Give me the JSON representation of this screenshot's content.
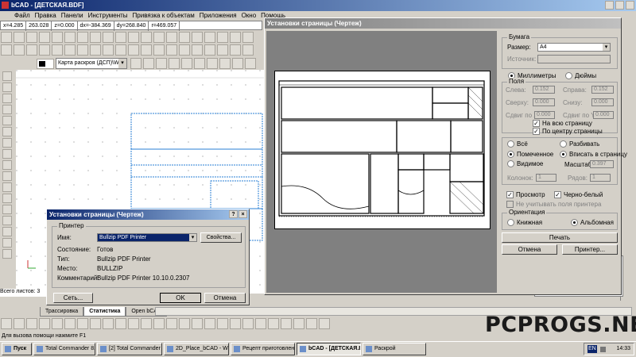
{
  "app": {
    "title": "bCAD - [ДЕТСКАЯ.BDF]",
    "menu": [
      "Файл",
      "Правка",
      "Панели",
      "Инструменты",
      "Привязка к объектам",
      "Приложения",
      "Окно",
      "Помощь"
    ],
    "coords": [
      "x=4.285",
      "263.028",
      "z=0.000",
      "dx=-384.369",
      "dy=268.840",
      "r=469.057"
    ],
    "layer_value": "Карта раскроя (ДСП)\\WB",
    "status_tabs": [
      "Трассировка",
      "Статистика",
      "Open bCAD"
    ],
    "status_hint": "Для вызова помощи нажмите F1",
    "sheet_count": "Всего листов: 3"
  },
  "small_dialog": {
    "title": "Установки страницы (Чертеж)",
    "group_printer": "Принтер",
    "name_label": "Имя:",
    "name_value": "Bullzip PDF Printer",
    "props_button": "Свойства...",
    "rows": [
      {
        "label": "Состояние:",
        "value": "Готов"
      },
      {
        "label": "Тип:",
        "value": "Bullzip PDF Printer"
      },
      {
        "label": "Место:",
        "value": "BULLZIP"
      },
      {
        "label": "Комментарий:",
        "value": "Bullzip PDF Printer 10.10.0.2307"
      }
    ],
    "net_button": "Сеть...",
    "ok_button": "OK",
    "cancel_button": "Отмена"
  },
  "large_dialog": {
    "title": "Установки страницы (Чертеж)",
    "paper_group": "Бумага",
    "size_label": "Размер:",
    "size_value": "A4",
    "source_label": "Источник:",
    "millimeters": "Миллиметры",
    "inches": "Дюймы",
    "margins_group": "Поля",
    "left_label": "Слева:",
    "left_value": "0.152",
    "right_label": "Справа:",
    "right_value": "0.152",
    "top_label": "Сверху:",
    "top_value": "0.000",
    "bottom_label": "Снизу:",
    "bottom_value": "0.000",
    "shiftx_label": "Сдвиг по X:",
    "shiftx_value": "0.000",
    "shifty_label": "Сдвиг по Y:",
    "shifty_value": "0.000",
    "whole_page": "На всю страницу",
    "center_page": "По центру страницы",
    "all": "Всё",
    "split": "Разбивать",
    "marked": "Помеченное",
    "fit_page": "Вписать в страницу",
    "visible": "Видимое",
    "scale_label": "Масштаб:",
    "scale_value": "0.397",
    "columns_label": "Колонок:",
    "columns_value": "1",
    "rows_label": "Рядов:",
    "rows_value": "1",
    "preview": "Просмотр",
    "bw": "Черно-белый",
    "no_scale": "Не учитывать поля принтера",
    "orientation_group": "Ориентация",
    "portrait": "Книжная",
    "landscape": "Альбомная",
    "print_button": "Печать",
    "cancel_button": "Отмена",
    "printer_button": "Принтер..."
  },
  "taskbar": {
    "start": "Пуск",
    "items": [
      "Total Commander 8.51a ...",
      "[2] Total Commander 8.5...",
      "2D_Place_bCAD - WordPad",
      "Рецепт приготовления ...",
      "bCAD - [ДЕТСКАЯ.BDF]",
      "Раскрой"
    ],
    "lang": "EN",
    "time": "14:33"
  },
  "watermark": "PCPROGS.NET"
}
